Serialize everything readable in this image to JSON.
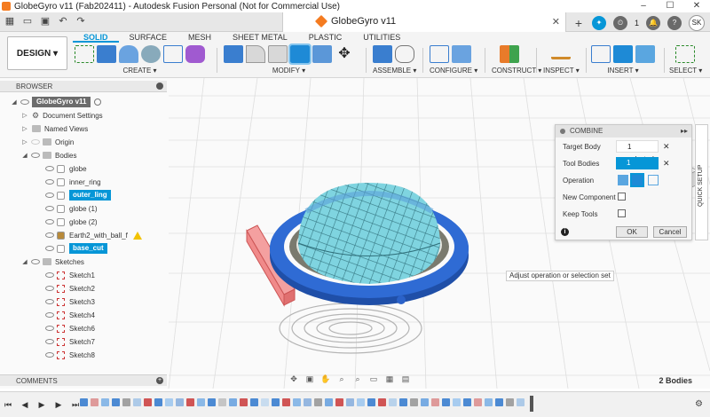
{
  "window": {
    "title": "GlobeGyro v11 (Fab202411) - Autodesk Fusion Personal (Not for Commercial Use)",
    "minimize": "–",
    "maximize": "☐",
    "close": "✕"
  },
  "doc_tab": {
    "title": "GlobeGyro v11",
    "close": "✕"
  },
  "tabbar_right": {
    "plus": "+",
    "badge_count": "1",
    "user_initials": "SK"
  },
  "ribbon": {
    "workspace": "DESIGN ▾",
    "tabs": [
      {
        "label": "SOLID",
        "active": true
      },
      {
        "label": "SURFACE"
      },
      {
        "label": "MESH"
      },
      {
        "label": "SHEET METAL"
      },
      {
        "label": "PLASTIC"
      },
      {
        "label": "UTILITIES"
      }
    ],
    "groups": {
      "create": "CREATE ▾",
      "modify": "MODIFY ▾",
      "assemble": "ASSEMBLE ▾",
      "configure": "CONFIGURE ▾",
      "construct": "CONSTRUCT ▾",
      "inspect": "INSPECT ▾",
      "insert": "INSERT ▾",
      "select": "SELECT ▾"
    }
  },
  "browser": {
    "title": "BROWSER",
    "root": "GlobeGyro v11",
    "items": [
      {
        "label": "Document Settings",
        "kind": "settings"
      },
      {
        "label": "Named Views",
        "kind": "folder"
      },
      {
        "label": "Origin",
        "kind": "folder"
      },
      {
        "label": "Bodies",
        "kind": "folder"
      },
      {
        "label": "globe",
        "kind": "body"
      },
      {
        "label": "inner_ring",
        "kind": "body"
      },
      {
        "label": "outer_ling",
        "kind": "body",
        "selected": true
      },
      {
        "label": "globe (1)",
        "kind": "body"
      },
      {
        "label": "globe (2)",
        "kind": "body"
      },
      {
        "label": "Earth2_with_ball_f",
        "kind": "body",
        "warning": true
      },
      {
        "label": "base_cut",
        "kind": "body",
        "selected": true
      },
      {
        "label": "Sketches",
        "kind": "folder"
      },
      {
        "label": "Sketch1",
        "kind": "sketch"
      },
      {
        "label": "Sketch2",
        "kind": "sketch"
      },
      {
        "label": "Sketch3",
        "kind": "sketch"
      },
      {
        "label": "Sketch4",
        "kind": "sketch"
      },
      {
        "label": "Sketch6",
        "kind": "sketch"
      },
      {
        "label": "Sketch7",
        "kind": "sketch"
      },
      {
        "label": "Sketch8",
        "kind": "sketch"
      }
    ]
  },
  "comments": {
    "title": "COMMENTS"
  },
  "combine": {
    "title": "COMBINE",
    "target_body_label": "Target Body",
    "target_body_value": "1 selected",
    "tool_bodies_label": "Tool Bodies",
    "tool_bodies_value": "1 selected",
    "operation_label": "Operation",
    "new_component_label": "New Component",
    "keep_tools_label": "Keep Tools",
    "ok": "OK",
    "cancel": "Cancel",
    "info": "i",
    "clear": "✕"
  },
  "quick_setup": "QUICK SETUP",
  "tooltip": "Adjust operation or selection set",
  "status": {
    "bodies": "2 Bodies"
  },
  "colors": {
    "accent": "#0696d7",
    "ring_blue": "#2b62c9",
    "globe_cyan": "#7fd4e0",
    "base_red": "#f08080"
  }
}
